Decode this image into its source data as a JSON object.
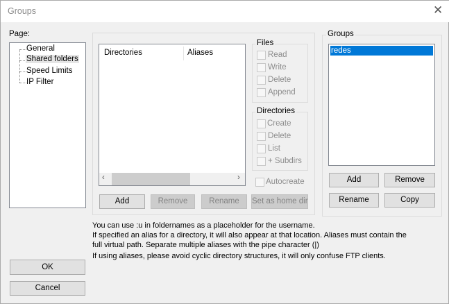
{
  "window": {
    "title": "Groups"
  },
  "page_label": "Page:",
  "tree": [
    "General",
    "Shared folders",
    "Speed Limits",
    "IP Filter"
  ],
  "shared": {
    "columns": [
      "Directories",
      "Aliases"
    ],
    "files_label": "Files",
    "files": [
      "Read",
      "Write",
      "Delete",
      "Append"
    ],
    "dirs_label": "Directories",
    "dirs": [
      "Create",
      "Delete",
      "List",
      "+ Subdirs"
    ],
    "autocreate": "Autocreate",
    "buttons": {
      "add": "Add",
      "remove": "Remove",
      "rename": "Rename",
      "home": "Set as home dir"
    }
  },
  "groups": {
    "label": "Groups",
    "items": [
      "redes"
    ],
    "add": "Add",
    "remove": "Remove",
    "rename": "Rename",
    "copy": "Copy"
  },
  "info": [
    "You can use :u in foldernames as a placeholder for the username.",
    "If specified an alias for a directory, it will also appear at that location. Aliases must contain the",
    "full virtual path. Separate multiple aliases with the pipe character (|)",
    "If using aliases, please avoid cyclic directory structures, it will only confuse FTP clients."
  ],
  "ok": "OK",
  "cancel": "Cancel",
  "colors": {
    "selection": "#0078d7"
  }
}
